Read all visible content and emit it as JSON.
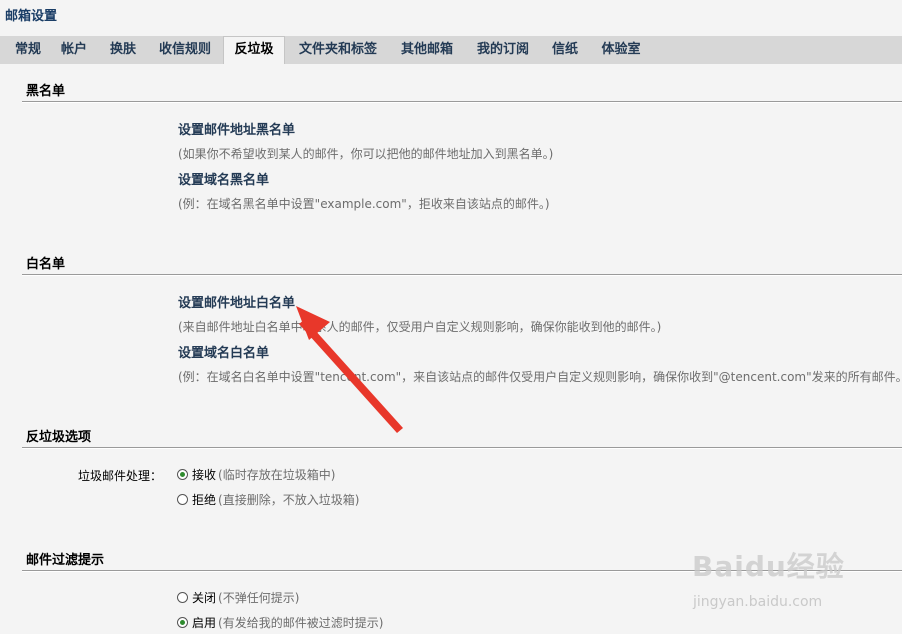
{
  "window": {
    "title": "邮箱设置"
  },
  "tabs": [
    {
      "label": "常规"
    },
    {
      "label": "帐户"
    },
    {
      "label": "换肤"
    },
    {
      "label": "收信规则"
    },
    {
      "label": "反垃圾"
    },
    {
      "label": "文件夹和标签"
    },
    {
      "label": "其他邮箱"
    },
    {
      "label": "我的订阅"
    },
    {
      "label": "信纸"
    },
    {
      "label": "体验室"
    }
  ],
  "active_tab": "反垃圾",
  "blacklist": {
    "title": "黑名单",
    "address_link": "设置邮件地址黑名单",
    "address_desc": "(如果你不希望收到某人的邮件，你可以把他的邮件地址加入到黑名单。)",
    "domain_link": "设置域名黑名单",
    "domain_desc": "(例：在域名黑名单中设置\"example.com\"，拒收来自该站点的邮件。)"
  },
  "whitelist": {
    "title": "白名单",
    "address_link": "设置邮件地址白名单",
    "address_desc": "(来自邮件地址白名单中联系人的邮件，仅受用户自定义规则影响，确保你能收到他的邮件。)",
    "domain_link": "设置域名白名单",
    "domain_desc": "(例：在域名白名单中设置\"tencent.com\"，来自该站点的邮件仅受用户自定义规则影响，确保你收到\"@tencent.com\"发来的所有邮件。"
  },
  "antispam": {
    "title": "反垃圾选项",
    "label": "垃圾邮件处理：",
    "options": [
      {
        "text": "接收",
        "hint": "(临时存放在垃圾箱中)",
        "checked": true
      },
      {
        "text": "拒绝",
        "hint": "(直接删除，不放入垃圾箱)",
        "checked": false
      }
    ]
  },
  "filter_tip": {
    "title": "邮件过滤提示",
    "options": [
      {
        "text": "关闭",
        "hint": "(不弹任何提示)",
        "checked": false
      },
      {
        "text": "启用",
        "hint": "(有发给我的邮件被过滤时提示)",
        "checked": true
      }
    ]
  },
  "colors": {
    "accent_link": "#243b55",
    "tab_bar": "#d7d7d7",
    "arrow": "#e8372a",
    "radio_checked": "#2e8b2e"
  },
  "watermark": {
    "logo": "Baidu经验",
    "url": "jingyan.baidu.com"
  }
}
